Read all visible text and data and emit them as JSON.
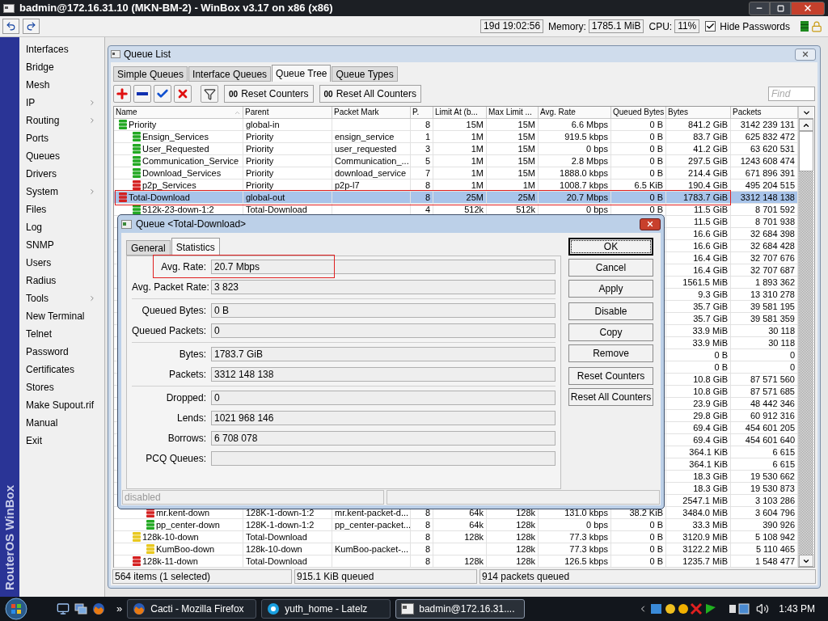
{
  "window": {
    "title": "badmin@172.16.31.10 (MKN-BM-2) - WinBox v3.17 on x86 (x86)"
  },
  "toolbar": {
    "uptime": "19d 19:02:56",
    "memory_label": "Memory:",
    "memory": "1785.1 MiB",
    "cpu_label": "CPU:",
    "cpu": "11%",
    "hide_passwords": {
      "label": "Hide Passwords",
      "checked": true
    }
  },
  "side_banner": "RouterOS WinBox",
  "sidebar": {
    "items": [
      {
        "label": "Interfaces",
        "submenu": false
      },
      {
        "label": "Bridge",
        "submenu": false
      },
      {
        "label": "Mesh",
        "submenu": false
      },
      {
        "label": "IP",
        "submenu": true
      },
      {
        "label": "Routing",
        "submenu": true
      },
      {
        "label": "Ports",
        "submenu": false
      },
      {
        "label": "Queues",
        "submenu": false
      },
      {
        "label": "Drivers",
        "submenu": false
      },
      {
        "label": "System",
        "submenu": true
      },
      {
        "label": "Files",
        "submenu": false
      },
      {
        "label": "Log",
        "submenu": false
      },
      {
        "label": "SNMP",
        "submenu": false
      },
      {
        "label": "Users",
        "submenu": false
      },
      {
        "label": "Radius",
        "submenu": false
      },
      {
        "label": "Tools",
        "submenu": true
      },
      {
        "label": "New Terminal",
        "submenu": false
      },
      {
        "label": "Telnet",
        "submenu": false
      },
      {
        "label": "Password",
        "submenu": false
      },
      {
        "label": "Certificates",
        "submenu": false
      },
      {
        "label": "Stores",
        "submenu": false
      },
      {
        "label": "Make Supout.rif",
        "submenu": false
      },
      {
        "label": "Manual",
        "submenu": false
      },
      {
        "label": "Exit",
        "submenu": false
      }
    ]
  },
  "queue_list": {
    "title": "Queue List",
    "tabs": [
      {
        "label": "Simple Queues",
        "selected": false
      },
      {
        "label": "Interface Queues",
        "selected": false
      },
      {
        "label": "Queue Tree",
        "selected": true
      },
      {
        "label": "Queue Types",
        "selected": false
      }
    ],
    "actions": [
      {
        "kind": "add"
      },
      {
        "kind": "remove"
      },
      {
        "kind": "enable"
      },
      {
        "kind": "disable"
      },
      {
        "kind": "filter"
      }
    ],
    "counter_buttons": [
      {
        "icon": "00",
        "label": "Reset Counters"
      },
      {
        "icon": "00",
        "label": "Reset All Counters"
      }
    ],
    "find": {
      "placeholder": "Find"
    },
    "table": {
      "columns": [
        {
          "label": "Name",
          "sorted": true
        },
        {
          "label": "Parent",
          "sorted": false
        },
        {
          "label": "Packet Mark",
          "sorted": false
        },
        {
          "label": "P.",
          "sorted": false
        },
        {
          "label": "Limit At (b...",
          "sorted": false
        },
        {
          "label": "Max Limit ...",
          "sorted": false
        },
        {
          "label": "Avg. Rate",
          "sorted": false
        },
        {
          "label": "Queued Bytes",
          "sorted": false
        },
        {
          "label": "Bytes",
          "sorted": false
        },
        {
          "label": "Packets",
          "sorted": false
        }
      ],
      "rows": [
        {
          "name": "Priority",
          "parent": "global-in",
          "priority": "8",
          "limit_at": "15M",
          "max_limit": "15M",
          "avg_rate": "6.6 Mbps",
          "queued_bytes": "0 B",
          "bytes": "841.2 GiB",
          "packets": "3142 239 131",
          "color": "#22a822",
          "selected": false,
          "annotated": false,
          "children": [
            {
              "name": "Ensign_Services",
              "parent": "Priority",
              "mark": "ensign_service",
              "priority": "1",
              "limit_at": "1M",
              "max_limit": "15M",
              "avg_rate": "919.5 kbps",
              "queued_bytes": "0 B",
              "bytes": "83.7 GiB",
              "packets": "625 832 472",
              "color": "#22a822",
              "selected": false,
              "annotated": false
            },
            {
              "name": "User_Requested",
              "parent": "Priority",
              "mark": "user_requested",
              "priority": "3",
              "limit_at": "1M",
              "max_limit": "15M",
              "avg_rate": "0 bps",
              "queued_bytes": "0 B",
              "bytes": "41.2 GiB",
              "packets": "63 620 531",
              "color": "#22a822",
              "selected": false,
              "annotated": false
            },
            {
              "name": "Communication_Service",
              "parent": "Priority",
              "mark": "Communication_...",
              "priority": "5",
              "limit_at": "1M",
              "max_limit": "15M",
              "avg_rate": "2.8 Mbps",
              "queued_bytes": "0 B",
              "bytes": "297.5 GiB",
              "packets": "1243 608 474",
              "color": "#22a822",
              "selected": false,
              "annotated": false
            },
            {
              "name": "Download_Services",
              "parent": "Priority",
              "mark": "download_service",
              "priority": "7",
              "limit_at": "1M",
              "max_limit": "15M",
              "avg_rate": "1888.0 kbps",
              "queued_bytes": "0 B",
              "bytes": "214.4 GiB",
              "packets": "671 896 391",
              "color": "#22a822",
              "selected": false,
              "annotated": false
            },
            {
              "name": "p2p_Services",
              "parent": "Priority",
              "mark": "p2p-l7",
              "priority": "8",
              "limit_at": "1M",
              "max_limit": "1M",
              "avg_rate": "1008.7 kbps",
              "queued_bytes": "6.5 KiB",
              "bytes": "190.4 GiB",
              "packets": "495 204 515",
              "color": "#d42020",
              "selected": false,
              "annotated": false
            }
          ]
        },
        {
          "name": "Total-Download",
          "parent": "global-out",
          "priority": "8",
          "limit_at": "25M",
          "max_limit": "25M",
          "avg_rate": "20.7 Mbps",
          "queued_bytes": "0 B",
          "bytes": "1783.7 GiB",
          "packets": "3312 148 138",
          "color": "#d42020",
          "selected": true,
          "annotated": true,
          "children": [
            {
              "name": "512k-23-down-1:2",
              "parent": "Total-Download",
              "priority": "4",
              "limit_at": "512k",
              "max_limit": "512k",
              "avg_rate": "0 bps",
              "queued_bytes": "0 B",
              "bytes": "11.5 GiB",
              "packets": "8 701 592",
              "color": "#22a822",
              "selected": false,
              "annotated": false
            },
            {
              "bytes": "11.5 GiB",
              "packets": "8 701 938",
              "selected": false,
              "annotated": false
            },
            {
              "bytes": "16.6 GiB",
              "packets": "32 684 398",
              "selected": false,
              "annotated": false
            },
            {
              "bytes": "16.6 GiB",
              "packets": "32 684 428",
              "selected": false,
              "annotated": false
            },
            {
              "bytes": "16.4 GiB",
              "packets": "32 707 676",
              "selected": false,
              "annotated": false
            },
            {
              "bytes": "16.4 GiB",
              "packets": "32 707 687",
              "selected": false,
              "annotated": false
            },
            {
              "bytes": "1561.5 MiB",
              "packets": "1 893 362",
              "selected": false,
              "annotated": false
            },
            {
              "bytes": "9.3 GiB",
              "packets": "13 310 278",
              "selected": false,
              "annotated": false
            },
            {
              "bytes": "35.7 GiB",
              "packets": "39 581 195",
              "selected": false,
              "annotated": false
            },
            {
              "bytes": "35.7 GiB",
              "packets": "39 581 359",
              "selected": false,
              "annotated": false
            },
            {
              "bytes": "33.9 MiB",
              "packets": "30 118",
              "selected": false,
              "annotated": false
            },
            {
              "bytes": "33.9 MiB",
              "packets": "30 118",
              "selected": false,
              "annotated": false
            },
            {
              "bytes": "0 B",
              "packets": "0",
              "selected": false,
              "annotated": false
            },
            {
              "bytes": "0 B",
              "packets": "0",
              "selected": false,
              "annotated": false
            },
            {
              "bytes": "10.8 GiB",
              "packets": "87 571 560",
              "selected": false,
              "annotated": false
            },
            {
              "bytes": "10.8 GiB",
              "packets": "87 571 685",
              "selected": false,
              "annotated": false
            },
            {
              "bytes": "23.9 GiB",
              "packets": "48 442 346",
              "selected": false,
              "annotated": false
            },
            {
              "bytes": "29.8 GiB",
              "packets": "60 912 316",
              "selected": false,
              "annotated": false
            },
            {
              "bytes": "69.4 GiB",
              "packets": "454 601 205",
              "selected": false,
              "annotated": false
            },
            {
              "bytes": "69.4 GiB",
              "packets": "454 601 640",
              "selected": false,
              "annotated": false
            },
            {
              "bytes": "364.1 KiB",
              "packets": "6 615",
              "selected": false,
              "annotated": false
            },
            {
              "bytes": "364.1 KiB",
              "packets": "6 615",
              "selected": false,
              "annotated": false
            },
            {
              "bytes": "18.3 GiB",
              "packets": "19 530 662",
              "selected": false,
              "annotated": false
            },
            {
              "bytes": "18.3 GiB",
              "packets": "19 530 873",
              "selected": false,
              "annotated": false
            },
            {
              "bytes": "2547.1 MiB",
              "packets": "3 103 286",
              "selected": false,
              "annotated": false,
              "children": [
                {
                  "name": "mr.kent-down",
                  "parent": "128K-1-down-1:2",
                  "mark": "mr.kent-packet-d...",
                  "priority": "8",
                  "limit_at": "64k",
                  "max_limit": "128k",
                  "avg_rate": "131.0 kbps",
                  "queued_bytes": "38.2 KiB",
                  "bytes": "3484.0 MiB",
                  "packets": "3 604 796",
                  "color": "#d42020",
                  "selected": false,
                  "annotated": false
                },
                {
                  "name": "pp_center-down",
                  "parent": "128K-1-down-1:2",
                  "mark": "pp_center-packet...",
                  "priority": "8",
                  "limit_at": "64k",
                  "max_limit": "128k",
                  "avg_rate": "0 bps",
                  "queued_bytes": "0 B",
                  "bytes": "33.3 MiB",
                  "packets": "390 926",
                  "color": "#22a822",
                  "selected": false,
                  "annotated": false
                }
              ]
            },
            {
              "name": "128k-10-down",
              "parent": "Total-Download",
              "priority": "8",
              "limit_at": "128k",
              "max_limit": "128k",
              "avg_rate": "77.3 kbps",
              "queued_bytes": "0 B",
              "bytes": "3120.9 MiB",
              "packets": "5 108 942",
              "color": "#e8c820",
              "selected": false,
              "annotated": false,
              "children": [
                {
                  "name": "KumBoo-down",
                  "parent": "128k-10-down",
                  "mark": "KumBoo-packet-...",
                  "priority": "8",
                  "max_limit": "128k",
                  "avg_rate": "77.3 kbps",
                  "queued_bytes": "0 B",
                  "bytes": "3122.2 MiB",
                  "packets": "5 110 465",
                  "color": "#e8c820",
                  "selected": false,
                  "annotated": false
                }
              ]
            },
            {
              "name": "128k-11-down",
              "parent": "Total-Download",
              "priority": "8",
              "limit_at": "128k",
              "max_limit": "128k",
              "avg_rate": "126.5 kbps",
              "queued_bytes": "0 B",
              "bytes": "1235.7 MiB",
              "packets": "1 548 477",
              "color": "#d42020",
              "selected": false,
              "annotated": false
            }
          ]
        }
      ]
    },
    "status_bar": [
      "564 items (1 selected)",
      "915.1 KiB queued",
      "914 packets queued"
    ]
  },
  "dialog": {
    "title": "Queue <Total-Download>",
    "tabs": [
      {
        "label": "General",
        "selected": false
      },
      {
        "label": "Statistics",
        "selected": true
      }
    ],
    "groups": [
      {
        "fields": [
          {
            "label": "Avg. Rate:",
            "value": "20.7 Mbps",
            "annotated": true
          },
          {
            "label": "Avg. Packet Rate:",
            "value": "3 823",
            "annotated": false
          }
        ]
      },
      {
        "fields": [
          {
            "label": "Queued Bytes:",
            "value": "0 B",
            "annotated": false
          },
          {
            "label": "Queued Packets:",
            "value": "0",
            "annotated": false
          }
        ]
      },
      {
        "fields": [
          {
            "label": "Bytes:",
            "value": "1783.7 GiB",
            "annotated": false
          },
          {
            "label": "Packets:",
            "value": "3312 148 138",
            "annotated": false
          }
        ]
      },
      {
        "fields": [
          {
            "label": "Dropped:",
            "value": "0",
            "annotated": false
          },
          {
            "label": "Lends:",
            "value": "1021 968 146",
            "annotated": false
          },
          {
            "label": "Borrows:",
            "value": "6 708 078",
            "annotated": false
          },
          {
            "label": "PCQ Queues:",
            "annotated": false
          }
        ]
      }
    ],
    "button_groups": [
      [
        {
          "label": "OK",
          "default": true
        },
        {
          "label": "Cancel",
          "default": false
        },
        {
          "label": "Apply",
          "default": false
        }
      ],
      [
        {
          "label": "Disable",
          "default": false
        },
        {
          "label": "Copy",
          "default": false
        },
        {
          "label": "Remove",
          "default": false
        }
      ],
      [
        {
          "label": "Reset Counters",
          "default": false
        },
        {
          "label": "Reset All Counters",
          "default": false
        }
      ]
    ],
    "status": "disabled"
  },
  "taskbar": {
    "overflow": "»",
    "tasks": [
      {
        "label": "Cacti - Mozilla Firefox",
        "kind": "firefox",
        "selected": false
      },
      {
        "label": "yuth_home - Latelz",
        "kind": "chat",
        "selected": false
      },
      {
        "label": "badmin@172.16.31....",
        "kind": "winbox",
        "selected": true
      }
    ],
    "clock": "1:43 PM"
  }
}
